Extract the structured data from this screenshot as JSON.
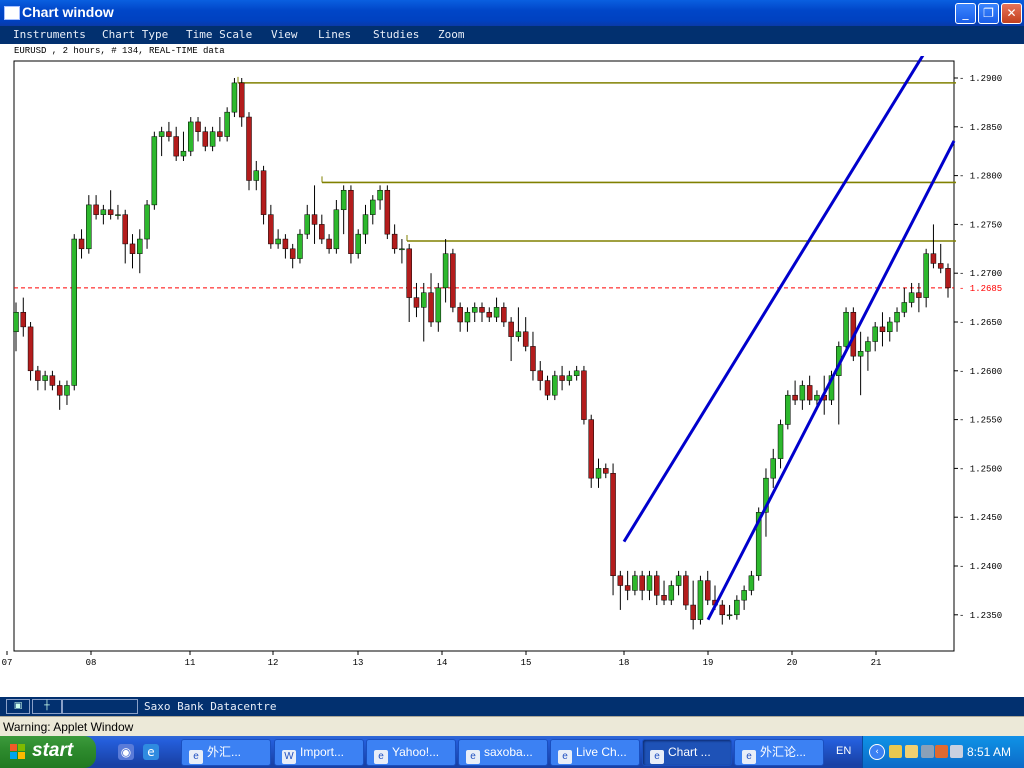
{
  "window": {
    "title": "Chart window",
    "controls": {
      "minimize": "_",
      "restore": "❐",
      "close": "✕"
    }
  },
  "menu": [
    {
      "label": "Instruments"
    },
    {
      "label": "Chart Type"
    },
    {
      "label": "Time Scale"
    },
    {
      "label": "View"
    },
    {
      "label": "Lines"
    },
    {
      "label": "Studies"
    },
    {
      "label": "Zoom"
    }
  ],
  "chart_info": "EURUSD , 2 hours, # 134, REAL-TIME data",
  "chart_data": {
    "type": "candlestick",
    "instrument": "EURUSD",
    "interval": "2 hours",
    "ylim": [
      1.233,
      1.292
    ],
    "y_ticks": [
      "1.2900",
      "1.2850",
      "1.2800",
      "1.2750",
      "1.2700",
      "1.2650",
      "1.2600",
      "1.2550",
      "1.2500",
      "1.2450",
      "1.2400",
      "1.2350"
    ],
    "x_labels": [
      "07",
      "08",
      "11",
      "12",
      "13",
      "14",
      "15",
      "18",
      "19",
      "20",
      "21"
    ],
    "current_price": {
      "value": 1.2685,
      "label": "1.2685",
      "color": "#ff0000"
    },
    "horizontal_lines": [
      {
        "level": 1.2895,
        "color": "#808000"
      },
      {
        "level": 1.2793,
        "color": "#808000"
      },
      {
        "level": 1.2733,
        "color": "#808000"
      }
    ],
    "channel_lines": [
      {
        "color": "#0000cc",
        "from": {
          "date": "18",
          "price": 1.2425
        },
        "to": {
          "date": "21",
          "price": 1.2845
        }
      },
      {
        "color": "#0000cc",
        "from": {
          "date": "19",
          "price": 1.2345
        },
        "to": {
          "date": "21",
          "price": 1.268
        }
      }
    ],
    "colors": {
      "up": "#2db82d",
      "down": "#b31c1c",
      "wick": "#000000"
    },
    "candles": [
      [
        1.264,
        1.267,
        1.262,
        1.266
      ],
      [
        1.266,
        1.2675,
        1.2635,
        1.2645
      ],
      [
        1.2645,
        1.265,
        1.259,
        1.26
      ],
      [
        1.26,
        1.2605,
        1.258,
        1.259
      ],
      [
        1.259,
        1.26,
        1.258,
        1.2595
      ],
      [
        1.2595,
        1.26,
        1.258,
        1.2585
      ],
      [
        1.2585,
        1.259,
        1.256,
        1.2575
      ],
      [
        1.2575,
        1.259,
        1.2565,
        1.2585
      ],
      [
        1.2585,
        1.274,
        1.258,
        1.2735
      ],
      [
        1.2735,
        1.2745,
        1.2715,
        1.2725
      ],
      [
        1.2725,
        1.278,
        1.272,
        1.277
      ],
      [
        1.277,
        1.278,
        1.2755,
        1.276
      ],
      [
        1.276,
        1.277,
        1.275,
        1.2765
      ],
      [
        1.2765,
        1.2785,
        1.2755,
        1.276
      ],
      [
        1.276,
        1.277,
        1.2755,
        1.276
      ],
      [
        1.276,
        1.2765,
        1.271,
        1.273
      ],
      [
        1.273,
        1.274,
        1.2705,
        1.272
      ],
      [
        1.272,
        1.2745,
        1.27,
        1.2735
      ],
      [
        1.2735,
        1.2775,
        1.2725,
        1.277
      ],
      [
        1.277,
        1.2845,
        1.2765,
        1.284
      ],
      [
        1.284,
        1.285,
        1.282,
        1.2845
      ],
      [
        1.2845,
        1.2855,
        1.2835,
        1.284
      ],
      [
        1.284,
        1.285,
        1.2815,
        1.282
      ],
      [
        1.282,
        1.2845,
        1.2815,
        1.2825
      ],
      [
        1.2825,
        1.286,
        1.282,
        1.2855
      ],
      [
        1.2855,
        1.286,
        1.2835,
        1.2845
      ],
      [
        1.2845,
        1.285,
        1.2825,
        1.283
      ],
      [
        1.283,
        1.285,
        1.2825,
        1.2845
      ],
      [
        1.2845,
        1.286,
        1.2835,
        1.284
      ],
      [
        1.284,
        1.287,
        1.2835,
        1.2865
      ],
      [
        1.2865,
        1.29,
        1.286,
        1.2895
      ],
      [
        1.2895,
        1.29,
        1.285,
        1.286
      ],
      [
        1.286,
        1.2865,
        1.2785,
        1.2795
      ],
      [
        1.2795,
        1.2815,
        1.2785,
        1.2805
      ],
      [
        1.2805,
        1.281,
        1.275,
        1.276
      ],
      [
        1.276,
        1.277,
        1.2725,
        1.273
      ],
      [
        1.273,
        1.2745,
        1.2725,
        1.2735
      ],
      [
        1.2735,
        1.274,
        1.2715,
        1.2725
      ],
      [
        1.2725,
        1.273,
        1.2705,
        1.2715
      ],
      [
        1.2715,
        1.2745,
        1.271,
        1.274
      ],
      [
        1.274,
        1.277,
        1.2735,
        1.276
      ],
      [
        1.276,
        1.279,
        1.273,
        1.275
      ],
      [
        1.275,
        1.276,
        1.273,
        1.2735
      ],
      [
        1.2735,
        1.274,
        1.272,
        1.2725
      ],
      [
        1.2725,
        1.2775,
        1.272,
        1.2765
      ],
      [
        1.2765,
        1.279,
        1.274,
        1.2785
      ],
      [
        1.2785,
        1.279,
        1.271,
        1.272
      ],
      [
        1.272,
        1.2745,
        1.2715,
        1.274
      ],
      [
        1.274,
        1.277,
        1.273,
        1.276
      ],
      [
        1.276,
        1.278,
        1.275,
        1.2775
      ],
      [
        1.2775,
        1.279,
        1.2765,
        1.2785
      ],
      [
        1.2785,
        1.279,
        1.2735,
        1.274
      ],
      [
        1.274,
        1.275,
        1.272,
        1.2725
      ],
      [
        1.2725,
        1.2735,
        1.271,
        1.2725
      ],
      [
        1.2725,
        1.273,
        1.265,
        1.2675
      ],
      [
        1.2675,
        1.269,
        1.2655,
        1.2665
      ],
      [
        1.2665,
        1.269,
        1.263,
        1.268
      ],
      [
        1.268,
        1.27,
        1.2645,
        1.265
      ],
      [
        1.265,
        1.269,
        1.264,
        1.2685
      ],
      [
        1.2685,
        1.2735,
        1.267,
        1.272
      ],
      [
        1.272,
        1.2725,
        1.266,
        1.2665
      ],
      [
        1.2665,
        1.267,
        1.264,
        1.265
      ],
      [
        1.265,
        1.2665,
        1.264,
        1.266
      ],
      [
        1.266,
        1.267,
        1.265,
        1.2665
      ],
      [
        1.2665,
        1.267,
        1.265,
        1.266
      ],
      [
        1.266,
        1.2665,
        1.265,
        1.2655
      ],
      [
        1.2655,
        1.2675,
        1.265,
        1.2665
      ],
      [
        1.2665,
        1.267,
        1.2645,
        1.265
      ],
      [
        1.265,
        1.2655,
        1.261,
        1.2635
      ],
      [
        1.2635,
        1.2665,
        1.263,
        1.264
      ],
      [
        1.264,
        1.2655,
        1.262,
        1.2625
      ],
      [
        1.2625,
        1.264,
        1.259,
        1.26
      ],
      [
        1.26,
        1.261,
        1.258,
        1.259
      ],
      [
        1.259,
        1.2595,
        1.257,
        1.2575
      ],
      [
        1.2575,
        1.26,
        1.257,
        1.2595
      ],
      [
        1.2595,
        1.2605,
        1.258,
        1.259
      ],
      [
        1.259,
        1.26,
        1.2585,
        1.2595
      ],
      [
        1.2595,
        1.2605,
        1.259,
        1.26
      ],
      [
        1.26,
        1.2605,
        1.2545,
        1.255
      ],
      [
        1.255,
        1.2555,
        1.248,
        1.249
      ],
      [
        1.249,
        1.251,
        1.248,
        1.25
      ],
      [
        1.25,
        1.2505,
        1.249,
        1.2495
      ],
      [
        1.2495,
        1.2505,
        1.237,
        1.239
      ],
      [
        1.239,
        1.2395,
        1.2355,
        1.238
      ],
      [
        1.238,
        1.2395,
        1.2365,
        1.2375
      ],
      [
        1.2375,
        1.2395,
        1.237,
        1.239
      ],
      [
        1.239,
        1.2395,
        1.2365,
        1.2375
      ],
      [
        1.2375,
        1.2395,
        1.2365,
        1.239
      ],
      [
        1.239,
        1.2395,
        1.236,
        1.237
      ],
      [
        1.237,
        1.2385,
        1.236,
        1.2365
      ],
      [
        1.2365,
        1.2385,
        1.236,
        1.238
      ],
      [
        1.238,
        1.2395,
        1.237,
        1.239
      ],
      [
        1.239,
        1.2395,
        1.2355,
        1.236
      ],
      [
        1.236,
        1.2385,
        1.2335,
        1.2345
      ],
      [
        1.2345,
        1.239,
        1.234,
        1.2385
      ],
      [
        1.2385,
        1.2395,
        1.236,
        1.2365
      ],
      [
        1.2365,
        1.238,
        1.2355,
        1.236
      ],
      [
        1.236,
        1.2365,
        1.234,
        1.235
      ],
      [
        1.235,
        1.236,
        1.2345,
        1.235
      ],
      [
        1.235,
        1.237,
        1.2345,
        1.2365
      ],
      [
        1.2365,
        1.238,
        1.2355,
        1.2375
      ],
      [
        1.2375,
        1.2395,
        1.237,
        1.239
      ],
      [
        1.239,
        1.246,
        1.2385,
        1.2455
      ],
      [
        1.2455,
        1.25,
        1.243,
        1.249
      ],
      [
        1.249,
        1.252,
        1.248,
        1.251
      ],
      [
        1.251,
        1.255,
        1.25,
        1.2545
      ],
      [
        1.2545,
        1.258,
        1.254,
        1.2575
      ],
      [
        1.2575,
        1.259,
        1.2565,
        1.257
      ],
      [
        1.257,
        1.259,
        1.256,
        1.2585
      ],
      [
        1.2585,
        1.2595,
        1.2565,
        1.257
      ],
      [
        1.257,
        1.258,
        1.256,
        1.2575
      ],
      [
        1.2575,
        1.2595,
        1.2555,
        1.257
      ],
      [
        1.257,
        1.26,
        1.2565,
        1.2595
      ],
      [
        1.2595,
        1.263,
        1.2545,
        1.2625
      ],
      [
        1.2625,
        1.2665,
        1.262,
        1.266
      ],
      [
        1.266,
        1.2665,
        1.261,
        1.2615
      ],
      [
        1.2615,
        1.264,
        1.2575,
        1.262
      ],
      [
        1.262,
        1.2635,
        1.26,
        1.263
      ],
      [
        1.263,
        1.265,
        1.262,
        1.2645
      ],
      [
        1.2645,
        1.266,
        1.2625,
        1.264
      ],
      [
        1.264,
        1.2655,
        1.263,
        1.265
      ],
      [
        1.265,
        1.2665,
        1.264,
        1.266
      ],
      [
        1.266,
        1.2685,
        1.2655,
        1.267
      ],
      [
        1.267,
        1.269,
        1.2665,
        1.268
      ],
      [
        1.268,
        1.269,
        1.266,
        1.2675
      ],
      [
        1.2675,
        1.2725,
        1.2665,
        1.272
      ],
      [
        1.272,
        1.275,
        1.2705,
        1.271
      ],
      [
        1.271,
        1.273,
        1.27,
        1.2705
      ],
      [
        1.2705,
        1.271,
        1.2675,
        1.2685
      ]
    ]
  },
  "status_bar": {
    "datacentre": "Saxo Bank Datacentre"
  },
  "warning": "Warning: Applet Window",
  "taskbar": {
    "start_label": "start",
    "tasks": [
      {
        "label": "外汇...",
        "active": false
      },
      {
        "label": "Import...",
        "active": false
      },
      {
        "label": "Yahoo!...",
        "active": false
      },
      {
        "label": "saxoba...",
        "active": false
      },
      {
        "label": "Live Ch...",
        "active": false
      },
      {
        "label": "Chart ...",
        "active": true
      },
      {
        "label": "外汇论...",
        "active": false
      }
    ],
    "language": "EN",
    "clock": "8:51 AM"
  }
}
